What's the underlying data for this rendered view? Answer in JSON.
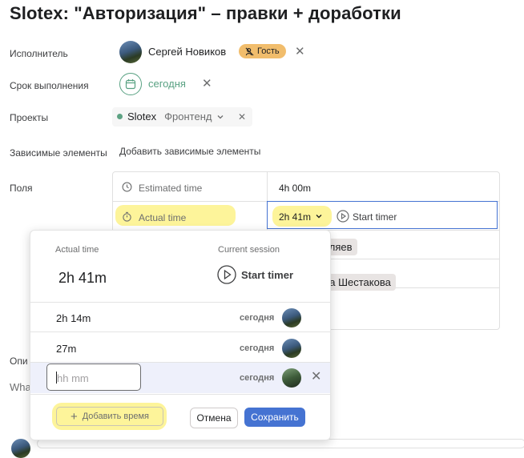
{
  "task": {
    "title": "Slotex: \"Авторизация\" – правки + доработки"
  },
  "assignee": {
    "label": "Исполнитель",
    "name": "Сергей Новиков",
    "badge": "Гость"
  },
  "due": {
    "label": "Срок выполнения",
    "value": "сегодня"
  },
  "projects": {
    "label": "Проекты",
    "project": "Slotex",
    "section": "Фронтенд"
  },
  "dependencies": {
    "label": "Зависимые элементы",
    "add": "Добавить зависимые элементы"
  },
  "fields": {
    "label": "Поля",
    "rows": [
      {
        "name": "Estimated time",
        "value": "4h 00m"
      },
      {
        "name": "Actual time",
        "value": "2h 41m",
        "action": "Start timer"
      }
    ],
    "hidden_values": [
      "еляев",
      "ра Шестакова"
    ]
  },
  "background_fragments": {
    "desc_label": "Опи",
    "desc_placeholder": "Wha"
  },
  "popup": {
    "actual_label": "Actual time",
    "actual_value": "2h 41m",
    "session_label": "Current session",
    "start_timer": "Start timer",
    "entries": [
      {
        "time": "2h 14m",
        "date": "сегодня"
      },
      {
        "time": "27m",
        "date": "сегодня"
      }
    ],
    "new_entry": {
      "placeholder": "hh mm",
      "date": "сегодня"
    },
    "add_time": "Добавить время",
    "cancel": "Отмена",
    "save": "Сохранить"
  },
  "colors": {
    "primary": "#4573d2",
    "highlight": "#fdf49a",
    "guest_badge": "#f1bd6c",
    "date_green": "#58a182"
  }
}
